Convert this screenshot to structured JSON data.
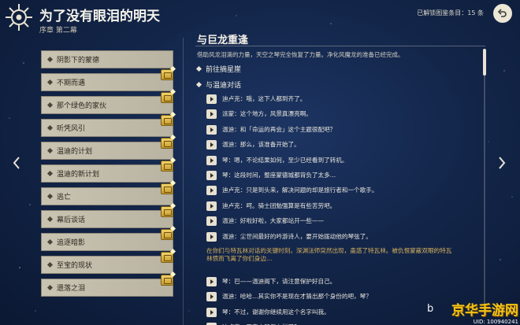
{
  "header": {
    "title": "为了没有眼泪的明天",
    "subtitle": "序章 第二幕",
    "count_text": "已解锁图鉴条目：15 条",
    "back_icon": "back-arrow-icon",
    "emblem_icon": "anemo-emblem-icon"
  },
  "quests": [
    {
      "label": "阴影下的蒙德",
      "badge": false
    },
    {
      "label": "不期而遇",
      "badge": true
    },
    {
      "label": "那个绿色的家伙",
      "badge": true
    },
    {
      "label": "听凭风引",
      "badge": true
    },
    {
      "label": "温迪的计划",
      "badge": true
    },
    {
      "label": "温迪的新计划",
      "badge": true
    },
    {
      "label": "逃亡",
      "badge": true
    },
    {
      "label": "幕后谈话",
      "badge": true
    },
    {
      "label": "追逐暗影",
      "badge": true
    },
    {
      "label": "至宝的现状",
      "badge": true
    },
    {
      "label": "遗落之泪",
      "badge": true
    }
  ],
  "panel": {
    "title": "与巨龙重逢",
    "description": "借助风龙泪滴的力量，天空之琴完全恢复了力量。净化风魔龙的准备已经完成。",
    "section1": "前往摘星崖",
    "section2": "与温迪对话",
    "dialogs": [
      {
        "text": "迪卢克：哦，这下人都到齐了。",
        "gold": false
      },
      {
        "text": "派蒙：这个地方，风景真漂亮啊。",
        "gold": false
      },
      {
        "text": "温迪：和「命运的再会」这个主题很配吧？",
        "gold": false
      },
      {
        "text": "温迪：那么，该准备开始了。",
        "gold": false
      },
      {
        "text": "琴：嗯，不论结果如何，至少已经看到了转机。",
        "gold": false
      },
      {
        "text": "琴：这段时间，整座蒙德城都背负了太多…",
        "gold": false
      },
      {
        "text": "迪卢克：只是到头来，解决问题的却是旅行者和一个歌手。",
        "gold": false
      },
      {
        "text": "迪卢克：呵。骑士团勉强算是有些苦劳吧。",
        "gold": false
      },
      {
        "text": "温迪：好啦好啦，大家都站开一些——",
        "gold": false
      },
      {
        "text": "温迪：尘世间最好的吟游诗人，要开始拨动他的琴弦了。",
        "gold": false
      },
      {
        "text": "在你们与特瓦林对话的关键时刻，深渊法师突然出现，蛊惑了特瓦林。被仇恨蒙蔽双眼的特瓦林愤而飞离了你们身边…",
        "gold": true
      },
      {
        "text": "琴：巴——温迪阁下，请注意保护好自己。",
        "gold": false
      },
      {
        "text": "温迪：哈哈…其实你不是现在才猜出那个身份的吧，琴？",
        "gold": false
      },
      {
        "text": "琴：不过，谢谢你继续用这个名字叫我。",
        "gold": false
      },
      {
        "text": "迪卢克：天空之琴怎么样了？",
        "gold": false
      }
    ]
  },
  "nav": {
    "left_icon": "chevron-left-icon",
    "right_icon": "chevron-right-icon"
  },
  "watermark": {
    "main": "京华手游网",
    "uid": "UID: 100940241",
    "left": "b"
  },
  "colors": {
    "background": "#13264a",
    "item_bg": "#c9c3b1",
    "gold_text": "#d8b25c",
    "badge": "#e3bb45",
    "watermark": "#f2c418"
  }
}
